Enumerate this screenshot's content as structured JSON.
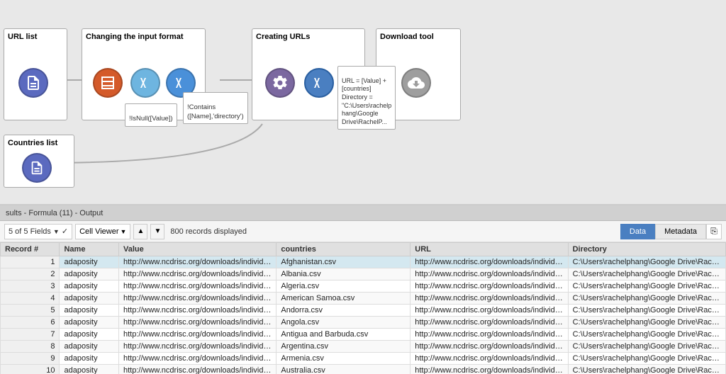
{
  "canvas": {
    "groups": [
      {
        "id": "url-list",
        "label": "URL list"
      },
      {
        "id": "changing",
        "label": "Changing the input format"
      },
      {
        "id": "creating",
        "label": "Creating URLs"
      },
      {
        "id": "download",
        "label": "Download tool"
      },
      {
        "id": "countries",
        "label": "Countries list"
      }
    ],
    "tooltip1": {
      "text": "!IsNull([Value])"
    },
    "tooltip2": {
      "text": "!Contains\n([Name],'directory')"
    },
    "tooltip3": {
      "text": "URL = [Value] +\n[countries]\nDirectory =\n\"C:\\Users\\rachelp\nhang\\Google\nDrive\\RachelP..."
    }
  },
  "results": {
    "header": "sults - Formula (11) - Output",
    "toolbar": {
      "fields_label": "5 of 5 Fields",
      "cell_viewer": "Cell Viewer",
      "records_label": "800 records displayed",
      "tab_data": "Data",
      "tab_metadata": "Metadata"
    },
    "table": {
      "columns": [
        "Record #",
        "Name",
        "Value",
        "countries",
        "URL",
        "Directory"
      ],
      "rows": [
        [
          "1",
          "adaposity",
          "http://www.ncdrisc.org/downloads/individual-...",
          "Afghanistan.csv",
          "http://www.ncdrisc.org/downloads/individual-...",
          "C:\\Users\\rachelphang\\Google Drive\\RachelP\\N..."
        ],
        [
          "2",
          "adaposity",
          "http://www.ncdrisc.org/downloads/individual-...",
          "Albania.csv",
          "http://www.ncdrisc.org/downloads/individual-...",
          "C:\\Users\\rachelphang\\Google Drive\\RachelP\\N..."
        ],
        [
          "3",
          "adaposity",
          "http://www.ncdrisc.org/downloads/individual-...",
          "Algeria.csv",
          "http://www.ncdrisc.org/downloads/individual-...",
          "C:\\Users\\rachelphang\\Google Drive\\RachelP\\N..."
        ],
        [
          "4",
          "adaposity",
          "http://www.ncdrisc.org/downloads/individual-...",
          "American Samoa.csv",
          "http://www.ncdrisc.org/downloads/individual-...",
          "C:\\Users\\rachelphang\\Google Drive\\RachelP\\N..."
        ],
        [
          "5",
          "adaposity",
          "http://www.ncdrisc.org/downloads/individual-...",
          "Andorra.csv",
          "http://www.ncdrisc.org/downloads/individual-...",
          "C:\\Users\\rachelphang\\Google Drive\\RachelP\\N..."
        ],
        [
          "6",
          "adaposity",
          "http://www.ncdrisc.org/downloads/individual-...",
          "Angola.csv",
          "http://www.ncdrisc.org/downloads/individual-...",
          "C:\\Users\\rachelphang\\Google Drive\\RachelP\\N..."
        ],
        [
          "7",
          "adaposity",
          "http://www.ncdrisc.org/downloads/individual-...",
          "Antigua and Barbuda.csv",
          "http://www.ncdrisc.org/downloads/individual-...",
          "C:\\Users\\rachelphang\\Google Drive\\RachelP\\N..."
        ],
        [
          "8",
          "adaposity",
          "http://www.ncdrisc.org/downloads/individual-...",
          "Argentina.csv",
          "http://www.ncdrisc.org/downloads/individual-...",
          "C:\\Users\\rachelphang\\Google Drive\\RachelP\\N..."
        ],
        [
          "9",
          "adaposity",
          "http://www.ncdrisc.org/downloads/individual-...",
          "Armenia.csv",
          "http://www.ncdrisc.org/downloads/individual-...",
          "C:\\Users\\rachelphang\\Google Drive\\RachelP\\N..."
        ],
        [
          "10",
          "adaposity",
          "http://www.ncdrisc.org/downloads/individual-...",
          "Australia.csv",
          "http://www.ncdrisc.org/downloads/individual-...",
          "C:\\Users\\rachelphang\\Google Drive\\RachelP\\N..."
        ]
      ]
    }
  }
}
